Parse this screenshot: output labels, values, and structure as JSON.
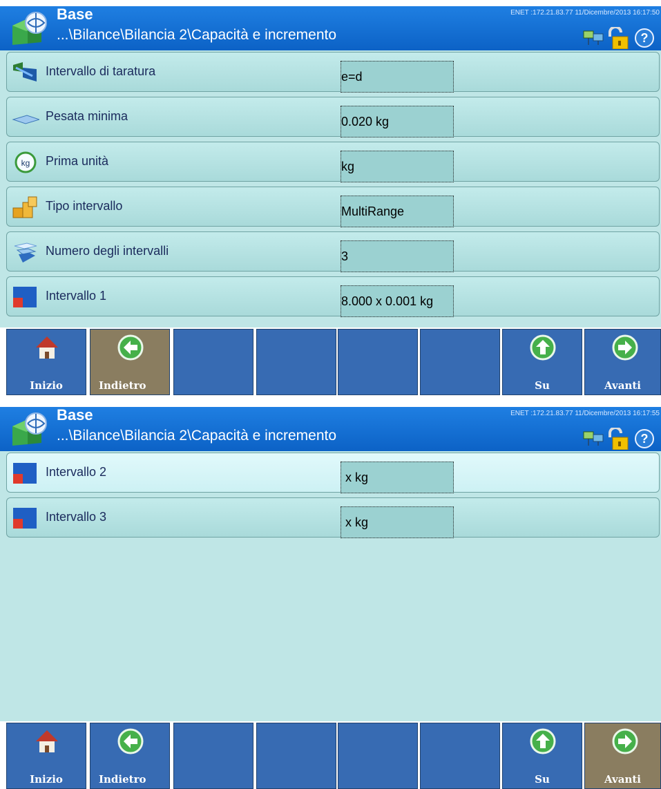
{
  "screen1": {
    "title": "Base",
    "path": "...\\Bilance\\Bilancia 2\\Capacità e incremento",
    "enet": "ENET :172.21.83.77  11/Dicembre/2013 16:17:50",
    "rows": [
      {
        "label": "Intervallo di taratura",
        "value": "e=d",
        "icon": "calibration-interval-icon"
      },
      {
        "label": "Pesata minima",
        "value": "0.020 kg",
        "icon": "minimum-weight-icon"
      },
      {
        "label": "Prima unità",
        "value": "kg",
        "icon": "kg-unit-icon"
      },
      {
        "label": "Tipo intervallo",
        "value": "MultiRange",
        "icon": "range-type-icon"
      },
      {
        "label": "Numero degli intervalli",
        "value": "3",
        "icon": "range-count-icon"
      },
      {
        "label": "Intervallo 1",
        "value": "8.000 x 0.001 kg",
        "icon": "range-square-icon"
      }
    ]
  },
  "screen2": {
    "title": "Base",
    "path": "...\\Bilance\\Bilancia 2\\Capacità e incremento",
    "enet": "ENET :172.21.83.77  11/Dicembre/2013 16:17:55",
    "rows": [
      {
        "label": "Intervallo 2",
        "value": "x  kg",
        "icon": "range-square-icon"
      },
      {
        "label": "Intervallo 3",
        "value": "x  kg",
        "icon": "range-square-icon"
      }
    ]
  },
  "toolbar": {
    "home_label": "Inizio",
    "back_label": "Indietro",
    "up_label": "Su",
    "next_label": "Avanti"
  },
  "colors": {
    "titlebar": "#0c62c6",
    "content_bg": "#bfe6e6",
    "button": "#376bb3",
    "button_active": "#8a7d60"
  }
}
